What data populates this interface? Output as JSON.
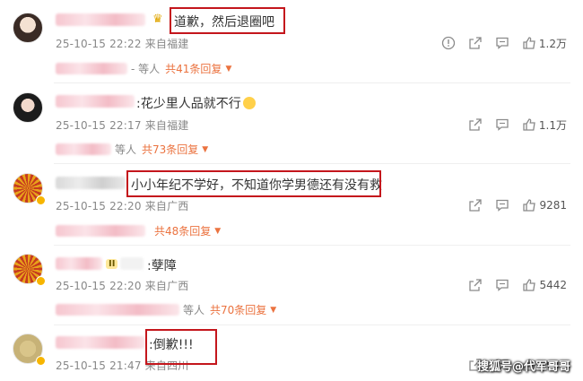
{
  "comments": [
    {
      "text": "道歉，然后退圈吧",
      "time": "25-10-15 22:22",
      "location": "来自福建",
      "likes": "1.2万",
      "reply_who": "- 等人",
      "reply_link": "共41条回复",
      "avatar_icon": "avatar-icon"
    },
    {
      "text": ":花少里人品就不行",
      "time": "25-10-15 22:17",
      "location": "来自福建",
      "likes": "1.1万",
      "reply_who": "等人",
      "reply_link": "共73条回复",
      "avatar_icon": "avatar-icon"
    },
    {
      "text": "小小年纪不学好，不知道你学男德还有没有救",
      "time": "25-10-15 22:20",
      "location": "来自广西",
      "likes": "9281",
      "reply_who": "",
      "reply_link": "共48条回复",
      "avatar_icon": "avatar-icon"
    },
    {
      "text": ":孽障",
      "time": "25-10-15 22:20",
      "location": "来自广西",
      "likes": "5442",
      "reply_who": "等人",
      "reply_link": "共70条回复",
      "avatar_icon": "avatar-icon"
    },
    {
      "text": ":倒歉!!!",
      "time": "25-10-15 21:47",
      "location": "来自四川",
      "likes": "2040",
      "reply_who": "",
      "reply_link": "",
      "avatar_icon": "avatar-icon"
    }
  ],
  "level_badge": "II",
  "watermark": "搜狐号@代军哥哥",
  "colors": {
    "highlight": "#c4161c",
    "reply_link": "#eb7340",
    "meta_text": "#888888"
  }
}
